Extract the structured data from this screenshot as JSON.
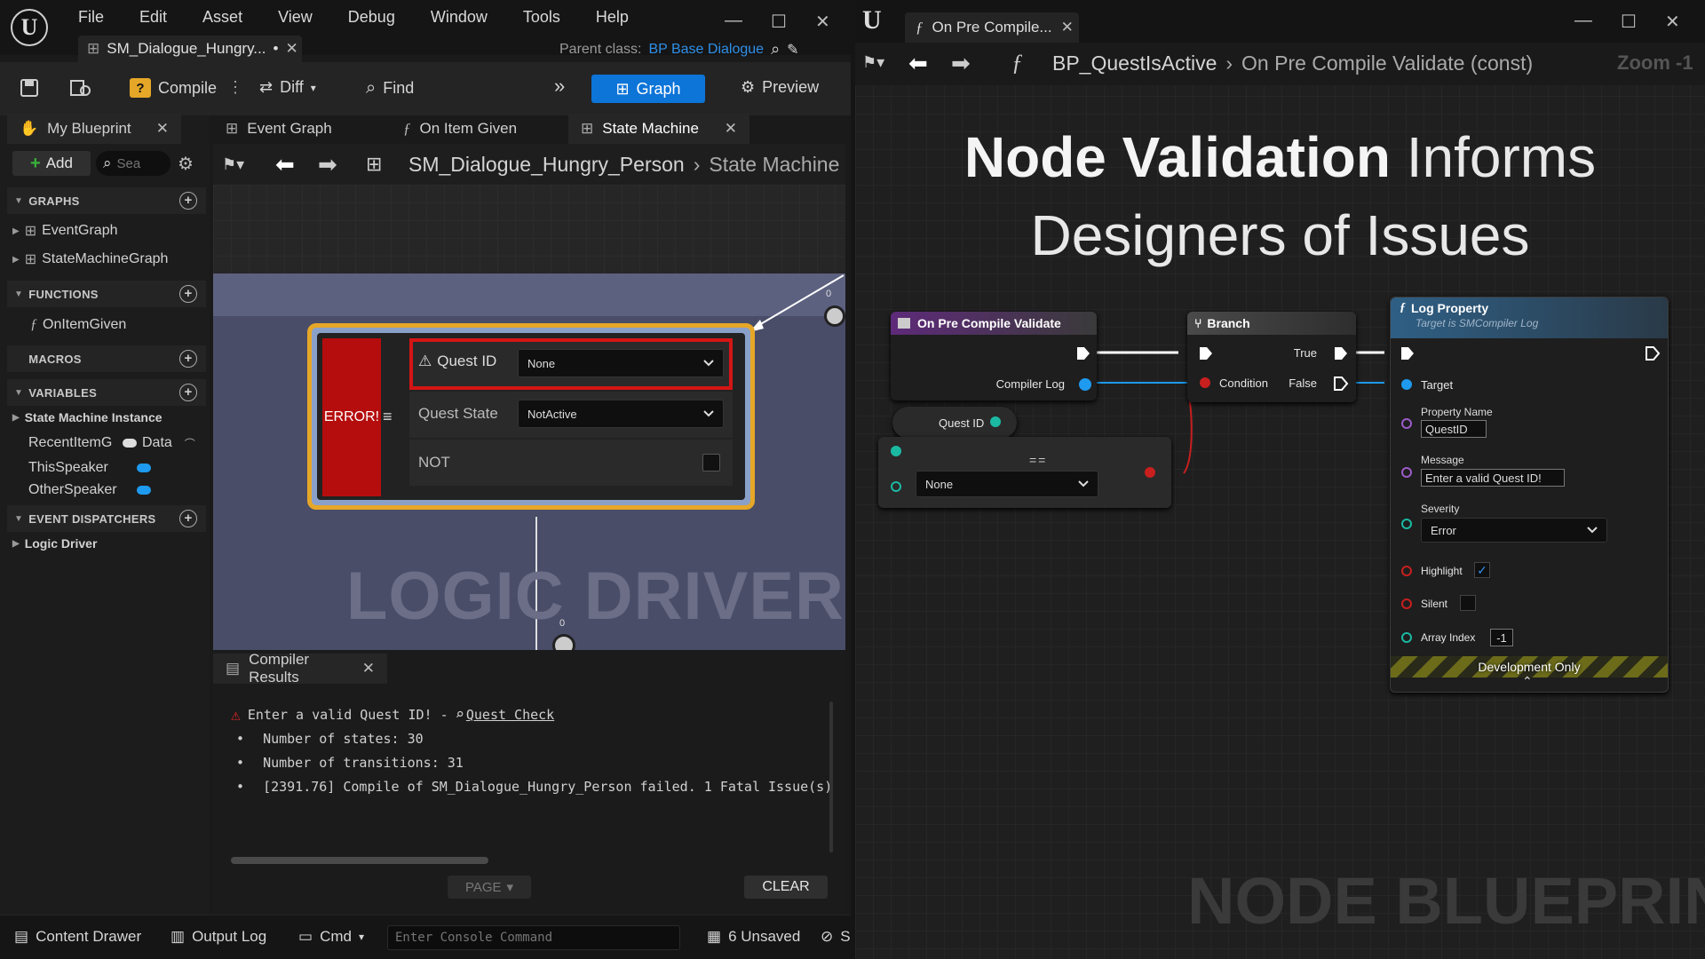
{
  "left": {
    "menu": [
      "File",
      "Edit",
      "Asset",
      "View",
      "Debug",
      "Window",
      "Tools",
      "Help"
    ],
    "doc_tab": "SM_Dialogue_Hungry...",
    "doc_tab_modified": "•",
    "parent_label": "Parent class:",
    "parent_value": "BP Base Dialogue",
    "toolbar": {
      "compile": "Compile",
      "diff": "Diff",
      "find": "Find",
      "graph": "Graph",
      "preview": "Preview"
    },
    "tabs": {
      "my_blueprint": "My Blueprint",
      "event_graph": "Event Graph",
      "on_item_given": "On Item Given",
      "state_machine": "State Machine"
    },
    "add_label": "Add",
    "search_placeholder": "Sea",
    "sections": {
      "graphs": "GRAPHS",
      "functions": "FUNCTIONS",
      "macros": "MACROS",
      "variables": "VARIABLES",
      "dispatchers": "EVENT DISPATCHERS"
    },
    "graphs": [
      "EventGraph",
      "StateMachineGraph"
    ],
    "functions": [
      "OnItemGiven"
    ],
    "variables": {
      "group": "State Machine Instance",
      "items": [
        {
          "name": "RecentItemG",
          "type": "Data"
        },
        {
          "name": "ThisSpeaker"
        },
        {
          "name": "OtherSpeaker"
        }
      ]
    },
    "logic_driver": "Logic Driver",
    "breadcrumb": [
      "SM_Dialogue_Hungry_Person",
      "State Machine"
    ],
    "state_node": {
      "error": "ERROR!",
      "quest_id_label": "Quest ID",
      "quest_id_value": "None",
      "quest_state_label": "Quest State",
      "quest_state_value": "NotActive",
      "not_label": "NOT"
    },
    "watermark": "LOGIC DRIVER",
    "pin_counts": [
      "0",
      "0"
    ],
    "compiler": {
      "tab": "Compiler Results",
      "error_line": "Enter a valid Quest ID! -",
      "error_link": "Quest Check",
      "lines": [
        "Number of states: 30",
        "Number of transitions: 31",
        "[2391.76] Compile of SM_Dialogue_Hungry_Person failed. 1 Fatal Issue(s)"
      ],
      "page": "PAGE",
      "clear": "CLEAR"
    },
    "status": {
      "content_drawer": "Content Drawer",
      "output_log": "Output Log",
      "cmd": "Cmd",
      "console_placeholder": "Enter Console Command",
      "unsaved": "6 Unsaved",
      "trailing": "S"
    }
  },
  "right": {
    "tab": "On Pre Compile...",
    "breadcrumb": [
      "BP_QuestIsActive",
      "On Pre Compile Validate (const)"
    ],
    "zoom": "Zoom -1",
    "headline_bold": "Node Validation",
    "headline_rest": "Informs",
    "headline_line2": "Designers of Issues",
    "validate_node": {
      "title": "On Pre Compile Validate",
      "compiler_log": "Compiler Log"
    },
    "branch_node": {
      "title": "Branch",
      "true": "True",
      "false": "False",
      "condition": "Condition"
    },
    "questid_getter": "Quest ID",
    "select_value": "None",
    "log_node": {
      "title": "Log Property",
      "subtitle": "Target is SMCompiler Log",
      "target": "Target",
      "property_name_label": "Property Name",
      "property_name_value": "QuestID",
      "message_label": "Message",
      "message_value": "Enter a valid Quest ID!",
      "severity_label": "Severity",
      "severity_value": "Error",
      "highlight": "Highlight",
      "silent": "Silent",
      "array_index_label": "Array Index",
      "array_index_value": "-1",
      "dev_only": "Development Only"
    },
    "watermark": "NODE BLUEPRINT"
  },
  "colors": {
    "accent": "#0d74d8",
    "error": "#b50d0d",
    "warning": "#e6a728",
    "exec": "#ffffff",
    "pin_blue": "#1e9bf0",
    "pin_purple": "#9c5bc8",
    "pin_teal": "#1bb9a2",
    "pin_red": "#c81f1f"
  }
}
